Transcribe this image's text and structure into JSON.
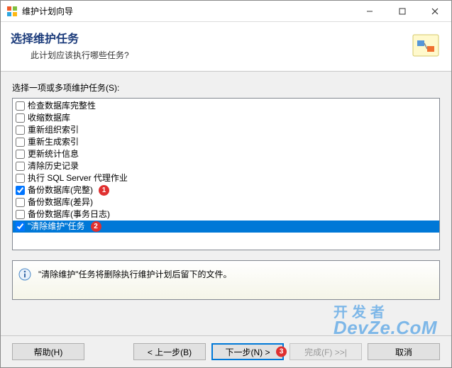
{
  "window": {
    "title": "维护计划向导"
  },
  "header": {
    "title": "选择维护任务",
    "subtitle": "此计划应该执行哪些任务?"
  },
  "list": {
    "label": "选择一项或多项维护任务(S):",
    "items": [
      {
        "label": "检查数据库完整性",
        "checked": false
      },
      {
        "label": "收缩数据库",
        "checked": false
      },
      {
        "label": "重新组织索引",
        "checked": false
      },
      {
        "label": "重新生成索引",
        "checked": false
      },
      {
        "label": "更新统计信息",
        "checked": false
      },
      {
        "label": "清除历史记录",
        "checked": false
      },
      {
        "label": "执行 SQL Server 代理作业",
        "checked": false
      },
      {
        "label": "备份数据库(完整)",
        "checked": true,
        "callout": "1"
      },
      {
        "label": "备份数据库(差异)",
        "checked": false
      },
      {
        "label": "备份数据库(事务日志)",
        "checked": false
      },
      {
        "label": "\"清除维护\"任务",
        "checked": true,
        "selected": true,
        "callout": "2"
      }
    ]
  },
  "description": {
    "text": "\"清除维护\"任务将删除执行维护计划后留下的文件。"
  },
  "buttons": {
    "help": "帮助(H)",
    "back": "< 上一步(B)",
    "next": "下一步(N) >",
    "next_callout": "3",
    "finish": "完成(F) >>|",
    "cancel": "取消"
  },
  "watermark": {
    "cn": "开发者",
    "en": "DevZe.CoM"
  }
}
